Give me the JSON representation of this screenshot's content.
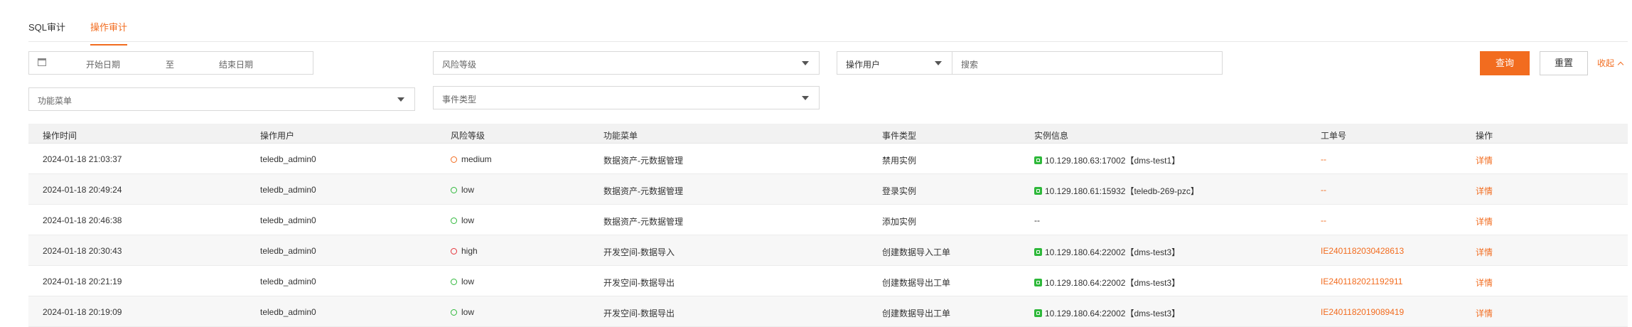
{
  "tabs": [
    {
      "label": "SQL审计",
      "active": false
    },
    {
      "label": "操作审计",
      "active": true
    }
  ],
  "filters": {
    "date_start_placeholder": "开始日期",
    "date_separator": "至",
    "date_end_placeholder": "结束日期",
    "risk_level_placeholder": "风险等级",
    "user_type_label": "操作用户",
    "search_placeholder": "搜索",
    "function_menu_placeholder": "功能菜单",
    "event_type_placeholder": "事件类型",
    "query_label": "查询",
    "reset_label": "重置",
    "collapse_label": "收起"
  },
  "table": {
    "columns": [
      "操作时间",
      "操作用户",
      "风险等级",
      "功能菜单",
      "事件类型",
      "实例信息",
      "工单号",
      "操作"
    ],
    "rows": [
      {
        "time": "2024-01-18 21:03:37",
        "user": "teledb_admin0",
        "risk": "medium",
        "menu": "数据资产-元数据管理",
        "event": "禁用实例",
        "instance": "10.129.180.63:17002【dms-test1】",
        "ticket": "--",
        "action": "详情"
      },
      {
        "time": "2024-01-18 20:49:24",
        "user": "teledb_admin0",
        "risk": "low",
        "menu": "数据资产-元数据管理",
        "event": "登录实例",
        "instance": "10.129.180.61:15932【teledb-269-pzc】",
        "ticket": "--",
        "action": "详情"
      },
      {
        "time": "2024-01-18 20:46:38",
        "user": "teledb_admin0",
        "risk": "low",
        "menu": "数据资产-元数据管理",
        "event": "添加实例",
        "instance": "--",
        "ticket": "--",
        "action": "详情"
      },
      {
        "time": "2024-01-18 20:30:43",
        "user": "teledb_admin0",
        "risk": "high",
        "menu": "开发空间-数据导入",
        "event": "创建数据导入工单",
        "instance": "10.129.180.64:22002【dms-test3】",
        "ticket": "IE2401182030428613",
        "action": "详情"
      },
      {
        "time": "2024-01-18 20:21:19",
        "user": "teledb_admin0",
        "risk": "low",
        "menu": "开发空间-数据导出",
        "event": "创建数据导出工单",
        "instance": "10.129.180.64:22002【dms-test3】",
        "ticket": "IE2401182021192911",
        "action": "详情"
      },
      {
        "time": "2024-01-18 20:19:09",
        "user": "teledb_admin0",
        "risk": "low",
        "menu": "开发空间-数据导出",
        "event": "创建数据导出工单",
        "instance": "10.129.180.64:22002【dms-test3】",
        "ticket": "IE2401182019089419",
        "action": "详情"
      }
    ]
  },
  "colors": {
    "accent": "#f26c1f",
    "risk_low": "#2eb83a",
    "risk_medium": "#f26c1f",
    "risk_high": "#e5333a",
    "instance_icon": "#2eb83a"
  },
  "icons": {
    "date": "calendar-icon",
    "dropdown": "chevron-down-icon",
    "risk": "shield-icon",
    "instance": "database-icon",
    "collapse": "chevron-up-icon"
  }
}
